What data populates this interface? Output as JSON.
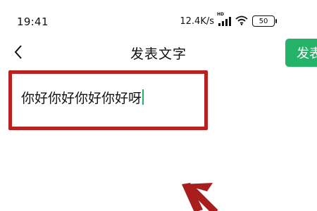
{
  "status_bar": {
    "time": "19:41",
    "net_speed": "12.4K/s",
    "signal_tag": "HD",
    "battery": "50",
    "icons": [
      "signal-icon",
      "wifi-icon",
      "battery-icon"
    ]
  },
  "header": {
    "back_icon": "chevron-left-icon",
    "title": "发表文字",
    "publish_label": "发表"
  },
  "editor": {
    "text": "你好你好你好你好呀"
  },
  "colors": {
    "accent": "#25b36a",
    "highlight": "#b8211f",
    "arrow": "#a81e1c"
  }
}
